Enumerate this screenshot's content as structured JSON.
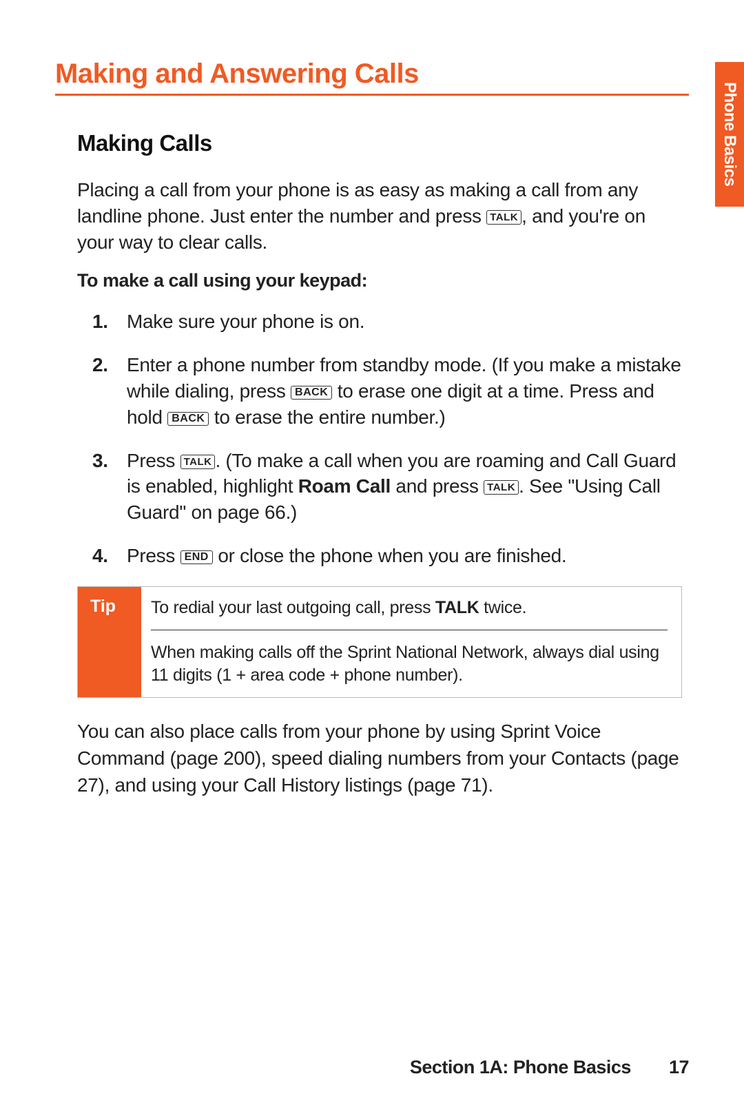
{
  "sideTab": "Phone Basics",
  "h1": "Making and Answering Calls",
  "h2": "Making Calls",
  "intro_a": "Placing a call from your phone is as easy as making a call from any landline phone. Just enter the number and press ",
  "intro_b": ", and you're on your way to clear calls.",
  "subhead": "To make a call using your keypad:",
  "keys": {
    "talk": "TALK",
    "back": "BACK",
    "end": "END"
  },
  "step1": "Make sure your phone is on.",
  "step2_a": "Enter a phone number from standby mode. (If you make a mistake while dialing, press ",
  "step2_b": " to erase one digit at a time. Press and hold ",
  "step2_c": " to erase the entire number.)",
  "step3_a": "Press ",
  "step3_b": ". (To make a call when you are roaming and Call Guard is enabled, highlight ",
  "step3_bold": "Roam Call",
  "step3_c": " and press ",
  "step3_d": ". See \"Using Call Guard\" on page 66.)",
  "step4_a": "Press ",
  "step4_b": " or close the phone when you are finished.",
  "tipLabel": "Tip",
  "tip1_a": "To redial your last outgoing call, press ",
  "tip1_bold": "TALK",
  "tip1_b": " twice.",
  "tip2": "When making calls off the Sprint National Network, always dial using 11 digits (1 + area code + phone number).",
  "after": "You can also place calls from your phone by using Sprint Voice Command (page 200), speed dialing numbers from your Contacts (page 27), and using your Call History listings (page 71).",
  "footerSection": "Section 1A: Phone Basics",
  "pageNumber": "17"
}
